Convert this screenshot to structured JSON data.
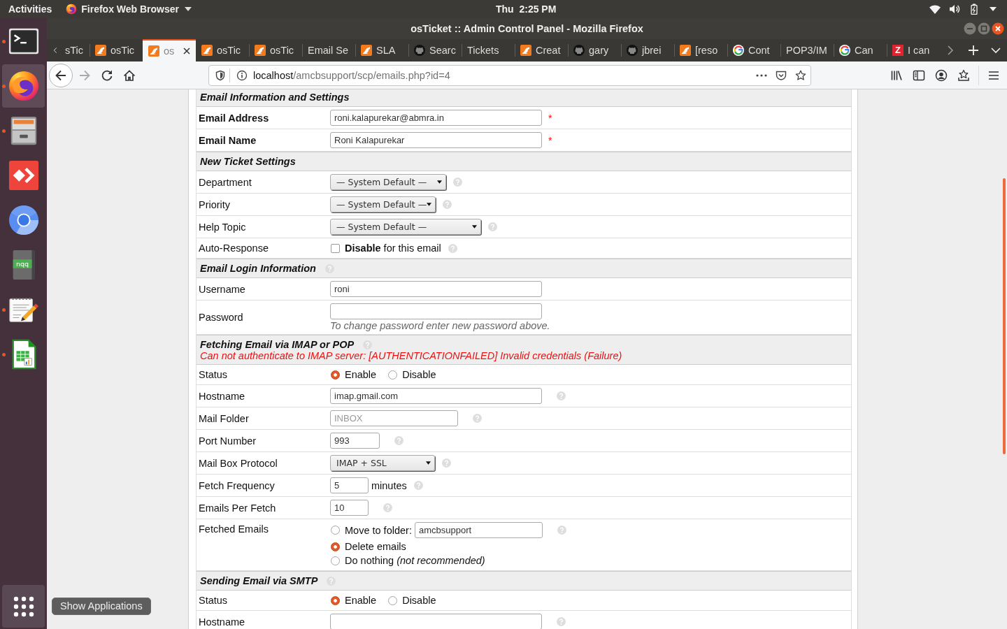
{
  "top_bar": {
    "activities": "Activities",
    "app_menu": "Firefox Web Browser",
    "clock": "Thu  2:25 PM"
  },
  "dock": {
    "items": [
      {
        "kind": "terminal",
        "running": true,
        "selected": false
      },
      {
        "kind": "fox",
        "running": true,
        "selected": true
      },
      {
        "kind": "cabinet",
        "running": true,
        "selected": false
      },
      {
        "kind": "arrows",
        "running": false,
        "selected": false
      },
      {
        "kind": "orb",
        "running": false,
        "selected": false
      },
      {
        "kind": "notebook",
        "text": "nqq",
        "running": false,
        "selected": false
      },
      {
        "kind": "notepad",
        "running": true,
        "selected": false
      },
      {
        "kind": "sheet",
        "running": true,
        "selected": false
      }
    ],
    "tooltip": "Show Applications"
  },
  "window": {
    "title": "osTicket :: Admin Control Panel - Mozilla Firefox"
  },
  "tabs": [
    {
      "label": "sTic",
      "kind": "plain",
      "selected": false
    },
    {
      "label": "osTic",
      "kind": "roo",
      "selected": false
    },
    {
      "label": "os",
      "kind": "roo",
      "selected": true
    },
    {
      "label": "osTic",
      "kind": "roo",
      "selected": false
    },
    {
      "label": "osTic",
      "kind": "roo",
      "selected": false
    },
    {
      "label": "Email Se",
      "kind": "plain",
      "selected": false
    },
    {
      "label": "SLA",
      "kind": "roo",
      "selected": false
    },
    {
      "label": "Searc",
      "kind": "cat",
      "selected": false
    },
    {
      "label": "Tickets",
      "kind": "plain",
      "selected": false
    },
    {
      "label": "Creat",
      "kind": "roo",
      "selected": false
    },
    {
      "label": "gary",
      "kind": "cat",
      "selected": false
    },
    {
      "label": "jbrei",
      "kind": "cat",
      "selected": false
    },
    {
      "label": "[reso",
      "kind": "roo",
      "selected": false
    },
    {
      "label": "Cont",
      "kind": "g",
      "selected": false
    },
    {
      "label": "POP3/IM",
      "kind": "plain",
      "selected": false
    },
    {
      "label": "Can",
      "kind": "g",
      "selected": false
    },
    {
      "label": "I can",
      "kind": "letter",
      "letter": "Z",
      "selected": false
    }
  ],
  "nav": {
    "forward_disabled": true
  },
  "url_bar": {
    "host": "localhost",
    "path": "/amcbsupport/scp/emails.php?id=4"
  },
  "form": {
    "sections": [
      {
        "title": "Email Information and Settings",
        "help": false,
        "rows": [
          {
            "label": "Email Address",
            "kind": "input",
            "value": "roni.kalapurekar@abmra.in",
            "required_mark": "*",
            "help": false
          },
          {
            "label": "Email Name",
            "kind": "input",
            "value": "Roni Kalapurekar",
            "required_mark": "*",
            "help": false
          }
        ]
      },
      {
        "title": "New Ticket Settings",
        "help": false,
        "rows": [
          {
            "label": "Department",
            "kind": "select",
            "value": "— System Default —",
            "help": true
          },
          {
            "label": "Priority",
            "kind": "select",
            "value": "— System Default —",
            "help": true
          },
          {
            "label": "Help Topic",
            "kind": "select",
            "value": "— System Default —",
            "help": true
          },
          {
            "label": "Auto-Response",
            "kind": "checkbox",
            "checked": false,
            "text": "**Disable** for this email",
            "help": true
          }
        ]
      },
      {
        "title": "Email Login Information",
        "help": true,
        "rows": [
          {
            "label": "Username",
            "kind": "input",
            "value": "roni",
            "help": false
          },
          {
            "label": "Password",
            "kind": "input",
            "hint": "To change password enter new password above.",
            "help": false
          }
        ]
      },
      {
        "title": "Fetching Email via IMAP or POP",
        "help": true,
        "error": "Can not authenticate to IMAP server: [AUTHENTICATIONFAILED] Invalid credentials (Failure)",
        "rows": [
          {
            "label": "Status",
            "kind": "radio",
            "options": [
              {
                "label": "Enable",
                "selected": true
              },
              {
                "label": "Disable",
                "selected": false
              }
            ]
          },
          {
            "label": "Hostname",
            "kind": "input",
            "value": "imap.gmail.com",
            "help": true
          },
          {
            "label": "Mail Folder",
            "kind": "input",
            "placeholder": "INBOX",
            "help": true
          },
          {
            "label": "Port Number",
            "kind": "input",
            "value": "993",
            "help": true
          },
          {
            "label": "Mail Box Protocol",
            "kind": "select",
            "value": "IMAP + SSL",
            "help": true
          },
          {
            "label": "Fetch Frequency",
            "kind": "input",
            "value": "5",
            "suffix": "minutes",
            "help": true
          },
          {
            "label": "Emails Per Fetch",
            "kind": "input",
            "value": "10",
            "help": true
          },
          {
            "label": "Fetched Emails",
            "kind": "radio_list",
            "help": true,
            "options": [
              {
                "label": "Move to folder:",
                "selected": false,
                "field_value": "amcbsupport"
              },
              {
                "label": "Delete emails",
                "selected": true
              },
              {
                "label": "Do nothing *(not recommended)*",
                "selected": false
              }
            ]
          }
        ]
      },
      {
        "title": "Sending Email via SMTP",
        "help": true,
        "rows": [
          {
            "label": "Status",
            "kind": "radio",
            "options": [
              {
                "label": "Enable",
                "selected": true
              },
              {
                "label": "Disable",
                "selected": false
              }
            ]
          },
          {
            "label": "Hostname",
            "kind": "input",
            "help": true
          }
        ]
      }
    ]
  }
}
